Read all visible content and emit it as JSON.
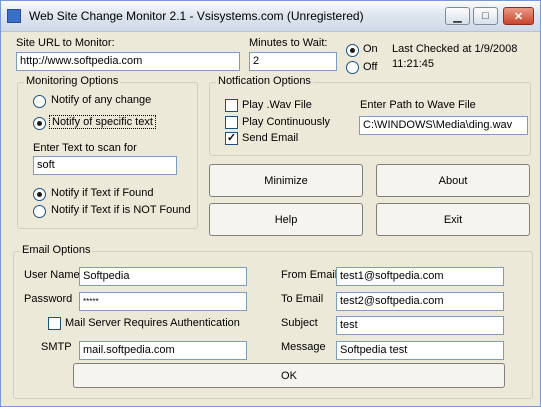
{
  "window": {
    "title": "Web Site Change Monitor 2.1 - Vsisystems.com (Unregistered)"
  },
  "titlebar": {
    "minimize_glyph": "▁",
    "maximize_glyph": "□",
    "close_glyph": "✕"
  },
  "top": {
    "url_label": "Site URL to Monitor:",
    "url_value": "http://www.softpedia.com",
    "minutes_label": "Minutes to Wait:",
    "minutes_value": "2",
    "on_label": "On",
    "off_label": "Off",
    "last_checked_line1": "Last Checked at 1/9/2008",
    "last_checked_line2": "11:21:45"
  },
  "monitoring": {
    "title": "Monitoring Options",
    "any_change": "Notify of any change",
    "specific_text": "Notify of specific text",
    "scan_label": "Enter Text to scan for",
    "scan_value": "soft",
    "if_found": "Notify if Text if Found",
    "if_not_found": "Notify if Text if is NOT Found"
  },
  "notification": {
    "title": "Notfication Options",
    "play_wav": "Play .Wav File",
    "play_continuously": "Play Continuously",
    "send_email": "Send Email",
    "wave_path_label": "Enter Path to Wave File",
    "wave_path_value": "C:\\WINDOWS\\Media\\ding.wav",
    "check_glyph": "✓"
  },
  "buttons": {
    "minimize": "Minimize",
    "about": "About",
    "help": "Help",
    "exit": "Exit",
    "ok": "OK"
  },
  "email": {
    "title": "Email Options",
    "user_label": "User Name",
    "user_value": "Softpedia",
    "password_label": "Password",
    "password_value": "*****",
    "auth_label": "Mail Server Requires Authentication",
    "smtp_label": "SMTP",
    "smtp_value": "mail.softpedia.com",
    "from_label": "From Email",
    "from_value": "test1@softpedia.com",
    "to_label": "To Email",
    "to_value": "test2@softpedia.com",
    "subject_label": "Subject",
    "subject_value": "test",
    "message_label": "Message",
    "message_value": "Softpedia test"
  }
}
